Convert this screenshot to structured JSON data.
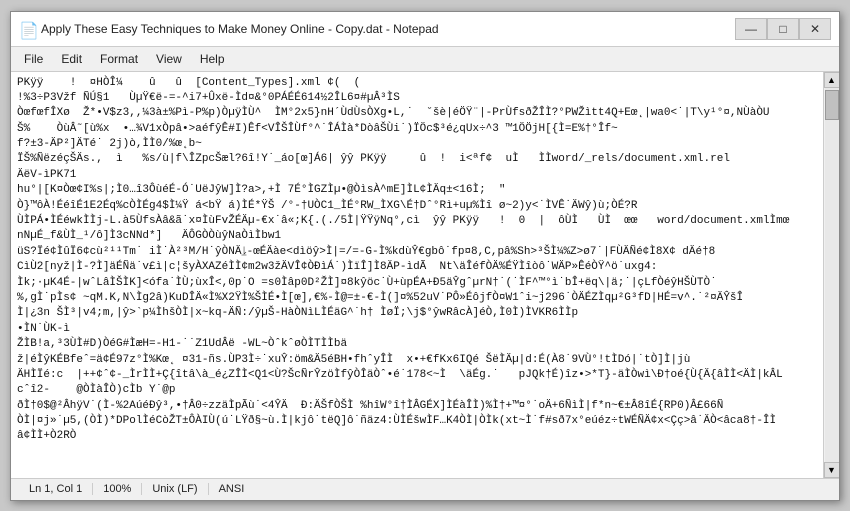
{
  "window": {
    "title": "Apply These Easy Techniques to Make Money Online - Copy.dat - Notepad",
    "icon": "📄"
  },
  "menu": {
    "items": [
      "File",
      "Edit",
      "Format",
      "View",
      "Help"
    ]
  },
  "content": {
    "text": "PKÿÿ    !  ¤HÒÎ¼    û   û  [Content_Types].xml ¢(  (\n!%3÷P3Vžf ÑÚ§1   ÙµŸ€ë-=-^i7+Ûxë-Ìd¤&°0PÁÉÉ614½2ÎL6¤#µÂ³ÌS\nÒœfœfÎXø  Ž*•V$z3,,¼3à±%Pì-P%p)ÒµÿÌÙ^  ÌM°2x5}nH´ÙdÙsÒXg•L,˙  ˘šè|éÖŸ¨|-PrÙfsðŽÎÌ?°PWŽìtt4Q+Eœ˛|wa0<˙|T\\y¹°¤,NÙàÒU\nŠ%    ÒùÂ˜[ù%x  •…¾V1xÒpâ•>aéfŷÊ#I)Êf<VÎŠÎÙf°^˙ÎÁÌà*DòâŠÙi˙)ÏÖc$³é¿qUx÷^3 ™1ÖÖjH[{Ì=E%†°Îf~\nf?±3-ÄP²]ÄTé˙ 2j)ò,ÌÌ0/%œ˛b~\nÏŠ%ÑëzéçŠÄs.,  ì   %s/ù|f\\ÎZpcŠæl?6î!Y˙_áo[œ]Á6| ŷŷ PKÿÿ     û  !  i<ªf¢  uÌ   ÌÌword/_rels/document.xml.rel\nÄëV-ìPK71\nhu°|[K¤Òœ¢I%s|;Ì0…î3ÔùéÉ-Ó˙UëJŷW]Ì?a>,+Ì 7É°ÌGZÌµ•@ÒìsÀ^mE]ÌL¢ÌÄq±<16Ì;  \"\nÒ}™ôÀ!ÉéîÉ1E2Éq%cÒÌÉg4$Ì¼Ÿ á<bŸ á)ÌÉ*ŸŠ /°-†UÒC1_ÌÉ°RW_ÌXG\\É†Dˆ°Rì+uµ%Ìî ø~2)y<˙ÌVÊ˙ÄWŷ)ù;ÒÉ?R\nÙÌPÁ•ÌÉéwkÌÌj-L.à5ÙfsÀâ&ã˙x¤ÌùFvŽÉÄµ-€x˙â«;K{.(./5Ì|ŸŸÿNq°,cì  ŷŷ PKÿÿ   !  0  |  ôÙÌ   ÙÌ  œœ   word/document.xmlÌmœ\nnNµÉ_f&ÙÌ_¹/ô]Ì3cNNd*]   ÄÔGÒÒùŷNaÒìÌbw1\nüS?Ïé¢ÌûÏ6¢cù²¹¹Tm˙ iÌ˙À²³M/H˙ŷÒNÄ⥕-œÉÄàe<dìöŷ>Ì|=/=-G-Ì%kdùŶ€gbô˙fp¤8,C,pâ%Sh>³ŠÌ¼%Z>ø7˙|FÙÄÑé¢Ì8X¢ dÄé†8\nCìÙ2[nyž|Ì-?Ì]äÉÑä˙v£ì|c¦šyÀXAZéÌÌ¢m2w3žÄVÎ¢ÒÐìÁ˙)ÌïÎ]Ì8ÄP-ìdÃ  Nt\\äÎéfÒÄ%ÉŸÌîòô˙WÄP»ÊéÒŸ^ö˙uxg4:\nÌk;·µK4É-|wˆLâÌŠÌK]<ófa˙ÌÙ;ùxÎ<,0p˙O =s0Ìâp0D²ŽÌ]¤8kŷöc˙Ù+ùpÉA+Ð5äŶgˆµrN†˙(˙ÌF^™°ì˙bÎ+ëq\\|ä;˙|çLfÒéŷHŠÙTÒ˙\n%,gÌ˙pÌs¢ ~qM.K,N\\Ìg2â)KuDÎÄ«Ì%X2ŸÌ%ŠÌÉ•Ì[œ],€%-Ì@=±-€-Ì(]¤%52uV˙PÔ»ÉôjfÒ¤W1ˆi~j296˙ÒÄÉZÌqµ²G³fD|HÉ=v^.˙²¤ÄŶšÎ\nÌ|¿3n ŠÌ³|v4;m,|ŷ>`p¼ÌhšÒÌ|x~kq-ÄÑ:/ŷµŠ-HàÒNìLÌÉäG^˙h† ÌøÏ;\\j$°ŷwRâcÀ]éÒ,Ì0Ì)ÌVKR6ÌÌp\n•ÌN˙ÙK-ì\nŽÌB!a,³3ÙÌ#D)ÒéG#ÌæH=-H1-˙˙Z1UdÂë -WL~ÒˆkˆøÒÌTÌÌbä\nž|éÌŷKÉBfeˆ=ä¢É97z°Ì%Kœ˛ ¤31-ñs.ÙP3Ì÷˙xuŶ:öm&Ä5éBH•fhˆyÎÌ  x•+€fKx6IQé ŠëÌÄµ|d:É(À8˙9VÙ°!tÌDó|˙tÒ]Ì|jù\nÄHÌÏé:c  |++¢ˆ¢-_ÌrÌÌ+Ç{îtâ\\à_é¿ZÎÌ<Q1<Ù?ŠcÑrŶzöÌfŷÒÎäÒˆ•é˙178<~Ì  \\äÉg.˙   pJQk†É)îz•>*T}-äÌÒwì\\Ð†oé{Ù{Ä{âÌÌ<ÄÌ|kÂL\ncˆî2-    @ÒÌàÎÒ)cÌb Y˙@p\nðÌ†0$@²ÂhÿV˙(Ì-%2AúéÐŷ³,•†Â0÷zzäÌpÃù˙<4ŶÄ  Ð:ÄŠfÒŠÌ %hîW°î†ÌÂGÉX]ÌÉàÎÌ)%Ì†+™¤°˙oÄ+6ÑìÌ|f*n~€±Â8îÉ{RP0)Â£66Ñ\nÒÌ|¤j»˙µ5,(ÒÌ)*DPolÌéCòŽT±ÔÀIÙ(ú˙LŸð§~ù.Ì|kjô˙tëQ]ô˙ñäz4:ÙÌÉšwÌF…K4ÒÌ|ÒÌk(xt~Ì˙f#sð7x°eúéz÷tWÉÑÄ¢x<Çç>â˙ÄÒ<âca8†-ÎÌ\nâ¢ÌÌ+Ò2RÒ"
  },
  "status_bar": {
    "position": "Ln 1, Col 1",
    "zoom": "100%",
    "line_ending": "Unix (LF)",
    "encoding": "ANSI"
  },
  "controls": {
    "minimize": "—",
    "maximize": "□",
    "close": "✕"
  }
}
